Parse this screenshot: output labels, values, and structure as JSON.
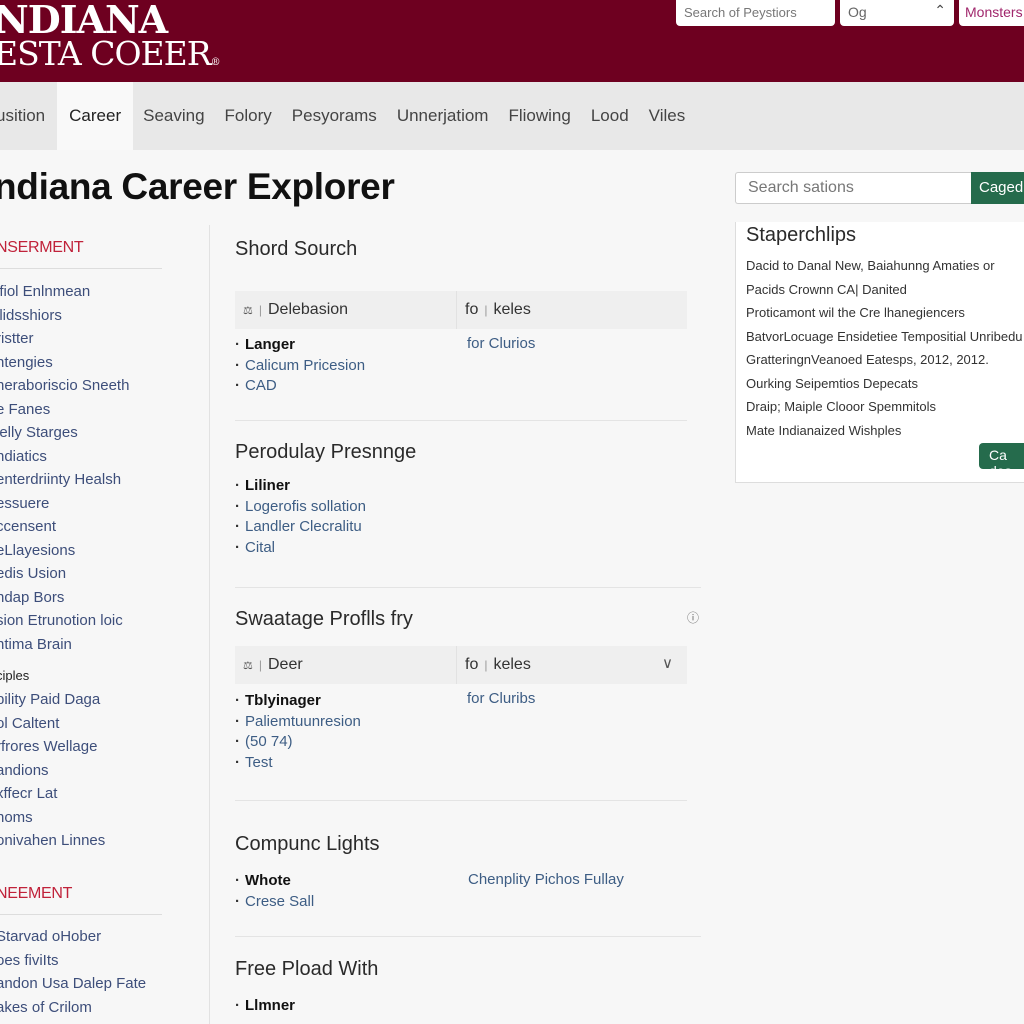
{
  "header": {
    "logo_line1": "NDIANA",
    "logo_line2": "ESTA COEER",
    "logo_mark": "®",
    "search_placeholder": "Search of Peystiors",
    "select_value": "Og",
    "select_icon": "chevron-up-icon",
    "monsters_label": "Monsters"
  },
  "nav": {
    "items": [
      {
        "label": "usition",
        "active": false
      },
      {
        "label": "Career",
        "active": true
      },
      {
        "label": "Seaving",
        "active": false
      },
      {
        "label": "Folory",
        "active": false
      },
      {
        "label": "Pesyorams",
        "active": false
      },
      {
        "label": "Unnerjatiom",
        "active": false
      },
      {
        "label": "Fliowing",
        "active": false
      },
      {
        "label": "Lood",
        "active": false
      },
      {
        "label": "Viles",
        "active": false
      }
    ]
  },
  "page_title": "ndiana Career Explorer",
  "side_search": {
    "placeholder": "Search sations",
    "button_label": "Caged"
  },
  "sidebar": {
    "heading1": "NSERMENT",
    "list1": [
      "ifiol Enlnmean",
      "llidsshiors",
      "ristter",
      "ntengies",
      "heraboriscio Sneeth",
      "e Fanes",
      "lelly Starges",
      "ndiatics",
      "enterdriinty Healsh",
      "essuere",
      "ccensent",
      "eLlayesions",
      "edis Usion",
      "ndap Bors",
      "sion Etrunotion loic",
      "ntima Brain"
    ],
    "subheading": "ciples",
    "list2": [
      "bility Paid Daga",
      "ol Caltent",
      "rfrores Wellage",
      "andions",
      "xffecr Lat",
      "noms",
      "onivahen Linnes"
    ],
    "heading2": "NEEMENT",
    "list3": [
      "Starvad oHober",
      "oes fiviIts",
      "andon Usa Dalep Fate",
      "akes of Crilom"
    ]
  },
  "main": {
    "sections": [
      {
        "title": "Shord Sourch",
        "header_col1_icon": "filter-icon",
        "header_col1": "Delebasion",
        "header_col2_prefix": "fo",
        "header_col2": "keles",
        "bullets": [
          {
            "text": "Langer",
            "bold": true
          },
          {
            "text": "Calicum Pricesion",
            "bold": false
          },
          {
            "text": "CAD",
            "bold": false
          }
        ],
        "right_link": "for Clurios"
      },
      {
        "title": "Perodulay Presnnge",
        "bullets": [
          {
            "text": "Liliner",
            "bold": true
          },
          {
            "text": "Logerofis sollation",
            "bold": false
          },
          {
            "text": "Landler Clecralitu",
            "bold": false
          },
          {
            "text": "Cital",
            "bold": false
          }
        ]
      },
      {
        "title": "Swaatage Proflls fry",
        "info_icon": "info-icon",
        "header_col1_icon": "filter-icon",
        "header_col1": "Deer",
        "header_col2_prefix": "fo",
        "header_col2": "keles",
        "header_chevron": "chevron-down-icon",
        "bullets": [
          {
            "text": "Tblyinager",
            "bold": true
          },
          {
            "text": "Paliemtuunresion",
            "bold": false
          },
          {
            "text": "(50 74)",
            "bold": false
          },
          {
            "text": "Test",
            "bold": false
          }
        ],
        "right_link": "for Cluribs"
      },
      {
        "title": "Compunc Lights",
        "bullets": [
          {
            "text": "Whote",
            "bold": true
          },
          {
            "text": "Crese Sall",
            "bold": false
          }
        ],
        "right_link": "Chenplity Pichos Fullay"
      },
      {
        "title": "Free Pload With",
        "bullets": [
          {
            "text": "Llmner",
            "bold": true
          }
        ]
      }
    ]
  },
  "panel": {
    "title": "Staperchlips",
    "lines": [
      "Dacid to Danal New, Baiahunng Amaties or",
      "Pacids Crownn CA| Danited",
      "Proticamont wil the Cre lhanegiencers",
      "BatvorLocuage Ensidetiee Tempositial Unribedu",
      "GratteringnVeanoed Eatesps, 2012, 2012.",
      "Ourking Seipemtios Depecats",
      "Draip; Maiple Clooor Spemmitols",
      "Mate Indianaized Wishples"
    ],
    "button_label": "Ca des"
  },
  "colors": {
    "brand": "#6e0020",
    "accent_red": "#c0223a",
    "link_blue": "#3d5d84",
    "button_green": "#256b4c",
    "monsters_pink": "#a0276c"
  }
}
